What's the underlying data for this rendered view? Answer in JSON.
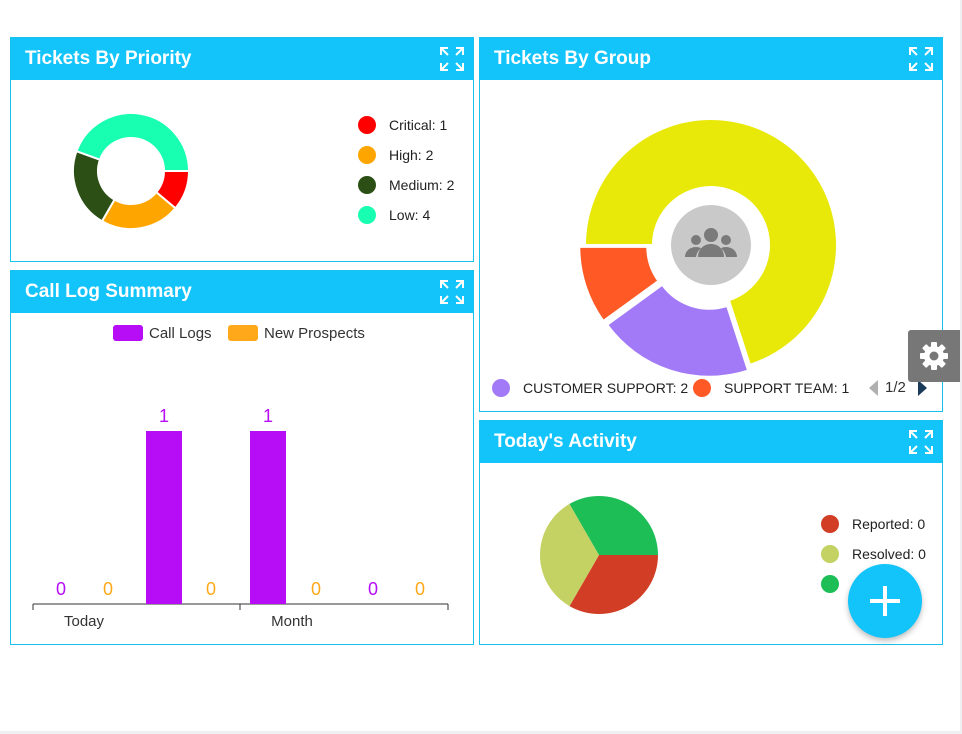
{
  "priority": {
    "title": "Tickets By Priority",
    "legend": [
      {
        "label": "Critical: 1",
        "color": "#ff0000"
      },
      {
        "label": "High: 2",
        "color": "#ffa500"
      },
      {
        "label": "Medium: 2",
        "color": "#2b4f14"
      },
      {
        "label": "Low: 4",
        "color": "#19ffb2"
      }
    ]
  },
  "group": {
    "title": "Tickets By Group",
    "legend": [
      {
        "label": "CUSTOMER SUPPORT: 2",
        "color": "#a27af7"
      },
      {
        "label": "SUPPORT TEAM: 1",
        "color": "#ff5a26"
      }
    ],
    "pager": "1/2",
    "center_icon": "users-group-icon"
  },
  "calllog": {
    "title": "Call Log Summary",
    "legend": [
      {
        "label": "Call Logs",
        "color": "#b60cf6"
      },
      {
        "label": "New Prospects",
        "color": "#ffa91a"
      }
    ]
  },
  "activity": {
    "title": "Today's Activity",
    "legend": [
      {
        "label": "Reported: 0",
        "color": "#d13e25"
      },
      {
        "label": "Resolved: 0",
        "color": "#c4d163"
      },
      {
        "label": "",
        "color": "#1ebe57"
      }
    ]
  },
  "chart_data": [
    {
      "type": "pie",
      "title": "Tickets By Priority",
      "donut": true,
      "categories": [
        "Critical",
        "High",
        "Medium",
        "Low"
      ],
      "values": [
        1,
        2,
        2,
        4
      ],
      "colors": [
        "#ff0000",
        "#ffa500",
        "#2b4f14",
        "#19ffb2"
      ]
    },
    {
      "type": "pie",
      "title": "Tickets By Group",
      "donut": true,
      "categories": [
        "(yellow segment, legend page 2)",
        "CUSTOMER SUPPORT",
        "SUPPORT TEAM"
      ],
      "values": [
        7,
        2,
        1
      ],
      "colors": [
        "#e8e809",
        "#a27af7",
        "#ff5a26"
      ]
    },
    {
      "type": "bar",
      "title": "Call Log Summary",
      "categories": [
        "Today",
        "Month"
      ],
      "series": [
        {
          "name": "Call Logs",
          "color": "#b60cf6",
          "values": [
            0,
            1,
            1,
            0
          ]
        },
        {
          "name": "New Prospects",
          "color": "#ffa91a",
          "values": [
            0,
            0,
            0,
            0
          ]
        }
      ],
      "bar_values_ordered": [
        0,
        0,
        1,
        0,
        1,
        0,
        0,
        0
      ],
      "grid": false
    },
    {
      "type": "pie",
      "title": "Today's Activity",
      "categories": [
        "Reported",
        "Resolved",
        ""
      ],
      "values": [
        1,
        1,
        1
      ],
      "colors": [
        "#d13e25",
        "#c4d163",
        "#1ebe57"
      ]
    }
  ],
  "icons": {
    "expand": "expand-icon",
    "gear": "gear-icon",
    "fab": "plus-icon",
    "prev": "chevron-left-icon",
    "next": "chevron-right-icon"
  }
}
